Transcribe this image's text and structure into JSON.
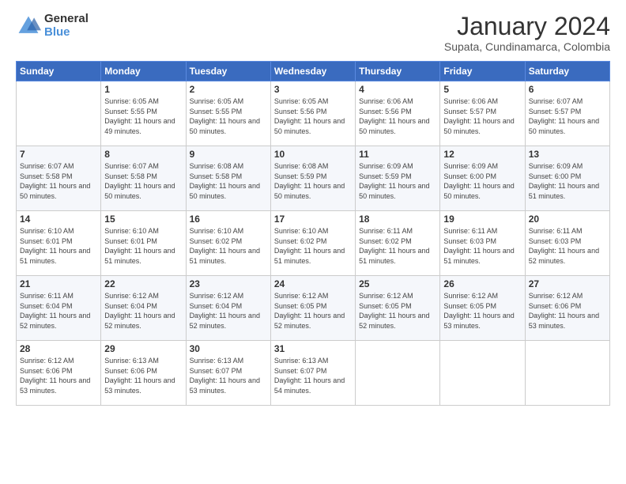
{
  "logo": {
    "general": "General",
    "blue": "Blue"
  },
  "title": "January 2024",
  "subtitle": "Supata, Cundinamarca, Colombia",
  "days_header": [
    "Sunday",
    "Monday",
    "Tuesday",
    "Wednesday",
    "Thursday",
    "Friday",
    "Saturday"
  ],
  "weeks": [
    [
      {
        "day": "",
        "sunrise": "",
        "sunset": "",
        "daylight": ""
      },
      {
        "day": "1",
        "sunrise": "Sunrise: 6:05 AM",
        "sunset": "Sunset: 5:55 PM",
        "daylight": "Daylight: 11 hours and 49 minutes."
      },
      {
        "day": "2",
        "sunrise": "Sunrise: 6:05 AM",
        "sunset": "Sunset: 5:55 PM",
        "daylight": "Daylight: 11 hours and 50 minutes."
      },
      {
        "day": "3",
        "sunrise": "Sunrise: 6:05 AM",
        "sunset": "Sunset: 5:56 PM",
        "daylight": "Daylight: 11 hours and 50 minutes."
      },
      {
        "day": "4",
        "sunrise": "Sunrise: 6:06 AM",
        "sunset": "Sunset: 5:56 PM",
        "daylight": "Daylight: 11 hours and 50 minutes."
      },
      {
        "day": "5",
        "sunrise": "Sunrise: 6:06 AM",
        "sunset": "Sunset: 5:57 PM",
        "daylight": "Daylight: 11 hours and 50 minutes."
      },
      {
        "day": "6",
        "sunrise": "Sunrise: 6:07 AM",
        "sunset": "Sunset: 5:57 PM",
        "daylight": "Daylight: 11 hours and 50 minutes."
      }
    ],
    [
      {
        "day": "7",
        "sunrise": "Sunrise: 6:07 AM",
        "sunset": "Sunset: 5:58 PM",
        "daylight": "Daylight: 11 hours and 50 minutes."
      },
      {
        "day": "8",
        "sunrise": "Sunrise: 6:07 AM",
        "sunset": "Sunset: 5:58 PM",
        "daylight": "Daylight: 11 hours and 50 minutes."
      },
      {
        "day": "9",
        "sunrise": "Sunrise: 6:08 AM",
        "sunset": "Sunset: 5:58 PM",
        "daylight": "Daylight: 11 hours and 50 minutes."
      },
      {
        "day": "10",
        "sunrise": "Sunrise: 6:08 AM",
        "sunset": "Sunset: 5:59 PM",
        "daylight": "Daylight: 11 hours and 50 minutes."
      },
      {
        "day": "11",
        "sunrise": "Sunrise: 6:09 AM",
        "sunset": "Sunset: 5:59 PM",
        "daylight": "Daylight: 11 hours and 50 minutes."
      },
      {
        "day": "12",
        "sunrise": "Sunrise: 6:09 AM",
        "sunset": "Sunset: 6:00 PM",
        "daylight": "Daylight: 11 hours and 50 minutes."
      },
      {
        "day": "13",
        "sunrise": "Sunrise: 6:09 AM",
        "sunset": "Sunset: 6:00 PM",
        "daylight": "Daylight: 11 hours and 51 minutes."
      }
    ],
    [
      {
        "day": "14",
        "sunrise": "Sunrise: 6:10 AM",
        "sunset": "Sunset: 6:01 PM",
        "daylight": "Daylight: 11 hours and 51 minutes."
      },
      {
        "day": "15",
        "sunrise": "Sunrise: 6:10 AM",
        "sunset": "Sunset: 6:01 PM",
        "daylight": "Daylight: 11 hours and 51 minutes."
      },
      {
        "day": "16",
        "sunrise": "Sunrise: 6:10 AM",
        "sunset": "Sunset: 6:02 PM",
        "daylight": "Daylight: 11 hours and 51 minutes."
      },
      {
        "day": "17",
        "sunrise": "Sunrise: 6:10 AM",
        "sunset": "Sunset: 6:02 PM",
        "daylight": "Daylight: 11 hours and 51 minutes."
      },
      {
        "day": "18",
        "sunrise": "Sunrise: 6:11 AM",
        "sunset": "Sunset: 6:02 PM",
        "daylight": "Daylight: 11 hours and 51 minutes."
      },
      {
        "day": "19",
        "sunrise": "Sunrise: 6:11 AM",
        "sunset": "Sunset: 6:03 PM",
        "daylight": "Daylight: 11 hours and 51 minutes."
      },
      {
        "day": "20",
        "sunrise": "Sunrise: 6:11 AM",
        "sunset": "Sunset: 6:03 PM",
        "daylight": "Daylight: 11 hours and 52 minutes."
      }
    ],
    [
      {
        "day": "21",
        "sunrise": "Sunrise: 6:11 AM",
        "sunset": "Sunset: 6:04 PM",
        "daylight": "Daylight: 11 hours and 52 minutes."
      },
      {
        "day": "22",
        "sunrise": "Sunrise: 6:12 AM",
        "sunset": "Sunset: 6:04 PM",
        "daylight": "Daylight: 11 hours and 52 minutes."
      },
      {
        "day": "23",
        "sunrise": "Sunrise: 6:12 AM",
        "sunset": "Sunset: 6:04 PM",
        "daylight": "Daylight: 11 hours and 52 minutes."
      },
      {
        "day": "24",
        "sunrise": "Sunrise: 6:12 AM",
        "sunset": "Sunset: 6:05 PM",
        "daylight": "Daylight: 11 hours and 52 minutes."
      },
      {
        "day": "25",
        "sunrise": "Sunrise: 6:12 AM",
        "sunset": "Sunset: 6:05 PM",
        "daylight": "Daylight: 11 hours and 52 minutes."
      },
      {
        "day": "26",
        "sunrise": "Sunrise: 6:12 AM",
        "sunset": "Sunset: 6:05 PM",
        "daylight": "Daylight: 11 hours and 53 minutes."
      },
      {
        "day": "27",
        "sunrise": "Sunrise: 6:12 AM",
        "sunset": "Sunset: 6:06 PM",
        "daylight": "Daylight: 11 hours and 53 minutes."
      }
    ],
    [
      {
        "day": "28",
        "sunrise": "Sunrise: 6:12 AM",
        "sunset": "Sunset: 6:06 PM",
        "daylight": "Daylight: 11 hours and 53 minutes."
      },
      {
        "day": "29",
        "sunrise": "Sunrise: 6:13 AM",
        "sunset": "Sunset: 6:06 PM",
        "daylight": "Daylight: 11 hours and 53 minutes."
      },
      {
        "day": "30",
        "sunrise": "Sunrise: 6:13 AM",
        "sunset": "Sunset: 6:07 PM",
        "daylight": "Daylight: 11 hours and 53 minutes."
      },
      {
        "day": "31",
        "sunrise": "Sunrise: 6:13 AM",
        "sunset": "Sunset: 6:07 PM",
        "daylight": "Daylight: 11 hours and 54 minutes."
      },
      {
        "day": "",
        "sunrise": "",
        "sunset": "",
        "daylight": ""
      },
      {
        "day": "",
        "sunrise": "",
        "sunset": "",
        "daylight": ""
      },
      {
        "day": "",
        "sunrise": "",
        "sunset": "",
        "daylight": ""
      }
    ]
  ]
}
